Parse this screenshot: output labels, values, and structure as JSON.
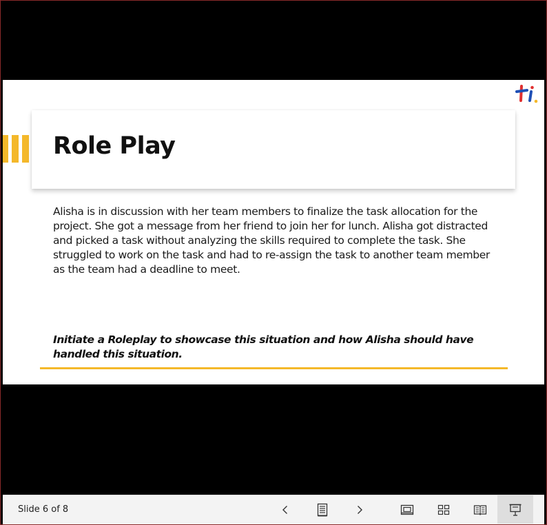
{
  "slide": {
    "title": "Role Play",
    "body": "Alisha is in discussion with her team members to finalize the task allocation for the project. She got a message from her friend to join her for lunch. Alisha got distracted and picked a task without analyzing the skills required to complete the task. She struggled to work on the task and had to re-assign the task to another team member as the team had a deadline to meet.",
    "instruction": "Initiate a Roleplay to showcase this situation and how Alisha should have handled this situation.",
    "logo_text": "ti",
    "accent_color": "#f4b82a"
  },
  "toolbar": {
    "slide_counter": "Slide 6 of 8",
    "buttons": [
      {
        "name": "previous-slide-button",
        "icon": "chevron-left-icon"
      },
      {
        "name": "notes-button",
        "icon": "notes-icon"
      },
      {
        "name": "next-slide-button",
        "icon": "chevron-right-icon"
      },
      {
        "name": "normal-view-button",
        "icon": "normal-view-icon"
      },
      {
        "name": "slide-sorter-button",
        "icon": "grid-icon"
      },
      {
        "name": "reading-view-button",
        "icon": "book-icon"
      },
      {
        "name": "slideshow-button",
        "icon": "presentation-icon",
        "active": true
      }
    ]
  }
}
